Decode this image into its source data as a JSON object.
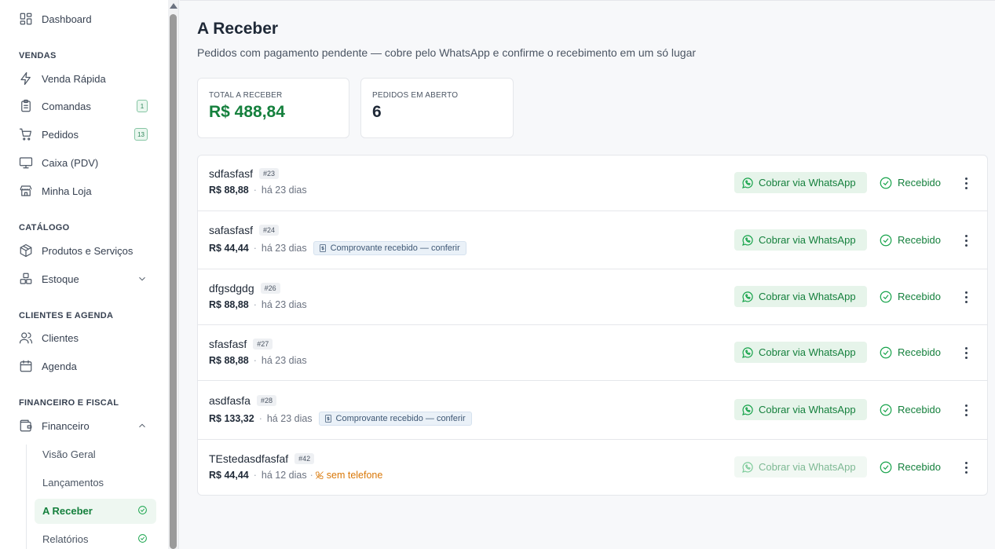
{
  "sidebar": {
    "dashboard": "Dashboard",
    "sections": {
      "vendas": "VENDAS",
      "catalogo": "CATÁLOGO",
      "clientes_agenda": "CLIENTES E AGENDA",
      "financeiro_fiscal": "FINANCEIRO E FISCAL"
    },
    "items": {
      "venda_rapida": "Venda Rápida",
      "comandas": "Comandas",
      "comandas_badge": "1",
      "pedidos": "Pedidos",
      "pedidos_badge": "13",
      "caixa": "Caixa (PDV)",
      "minha_loja": "Minha Loja",
      "produtos": "Produtos e Serviços",
      "estoque": "Estoque",
      "clientes": "Clientes",
      "agenda": "Agenda",
      "financeiro": "Financeiro"
    },
    "financeiro_sub": {
      "visao_geral": "Visão Geral",
      "lancamentos": "Lançamentos",
      "a_receber": "A Receber",
      "relatorios": "Relatórios"
    }
  },
  "page": {
    "title": "A Receber",
    "subtitle": "Pedidos com pagamento pendente — cobre pelo WhatsApp e confirme o recebimento em um só lugar"
  },
  "stats": {
    "total_label": "TOTAL A RECEBER",
    "total_value": "R$ 488,84",
    "open_label": "PEDIDOS EM ABERTO",
    "open_value": "6"
  },
  "actions": {
    "whatsapp": "Cobrar via WhatsApp",
    "received": "Recebido"
  },
  "orders": [
    {
      "name": "sdfasfasf",
      "number": "#23",
      "amount": "R$ 88,88",
      "age": "há 23 dias"
    },
    {
      "name": "safasfasf",
      "number": "#24",
      "amount": "R$ 44,44",
      "age": "há 23 dias",
      "receipt": "Comprovante recebido — conferir"
    },
    {
      "name": "dfgsdgdg",
      "number": "#26",
      "amount": "R$ 88,88",
      "age": "há 23 dias"
    },
    {
      "name": "sfasfasf",
      "number": "#27",
      "amount": "R$ 88,88",
      "age": "há 23 dias"
    },
    {
      "name": "asdfasfa",
      "number": "#28",
      "amount": "R$ 133,32",
      "age": "há 23 dias",
      "receipt": "Comprovante recebido — conferir"
    },
    {
      "name": "TEstedasdfasfaf",
      "number": "#42",
      "amount": "R$ 44,44",
      "age": "há 12 dias",
      "no_phone": "sem telefone"
    }
  ],
  "colors": {
    "accent": "#15803d",
    "warning": "#d97706"
  }
}
